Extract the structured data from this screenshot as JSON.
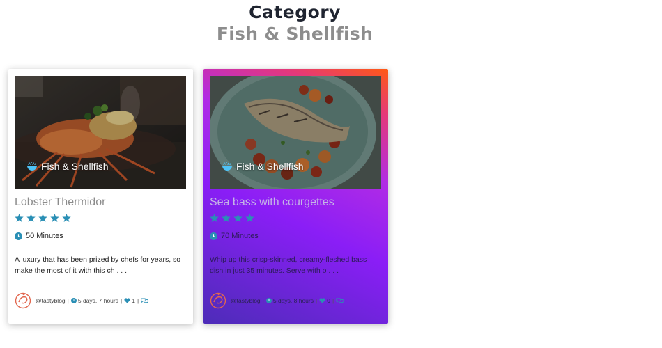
{
  "header": {
    "title": "Category",
    "subtitle": "Fish & Shellfish"
  },
  "cards": [
    {
      "category": "Fish & Shellfish",
      "title": "Lobster Thermidor",
      "rating": 5,
      "time": "50 Minutes",
      "description": "A luxury that has been prized by chefs for years, so make the most of it with this ch . . .",
      "author": "@tastyblog",
      "age": "5 days, 7 hours",
      "likes": "1"
    },
    {
      "category": "Fish & Shellfish",
      "title": "Sea bass with courgettes",
      "rating": 4,
      "time": "70 Minutes",
      "description": "Whip up this crisp-skinned, creamy-fleshed bass dish in just 35 minutes. Serve with o . . .",
      "author": "@tastyblog",
      "age": "5 days, 8 hours",
      "likes": "0"
    }
  ],
  "colors": {
    "accent": "#2a8fb5",
    "star": "#2a8fb5",
    "gradient_start": "#ff5a14",
    "gradient_end": "#8a1ef6"
  },
  "icons": [
    "fish-bowl-icon",
    "star-icon",
    "clock-icon",
    "heart-icon",
    "comment-icon",
    "avatar-logo"
  ]
}
